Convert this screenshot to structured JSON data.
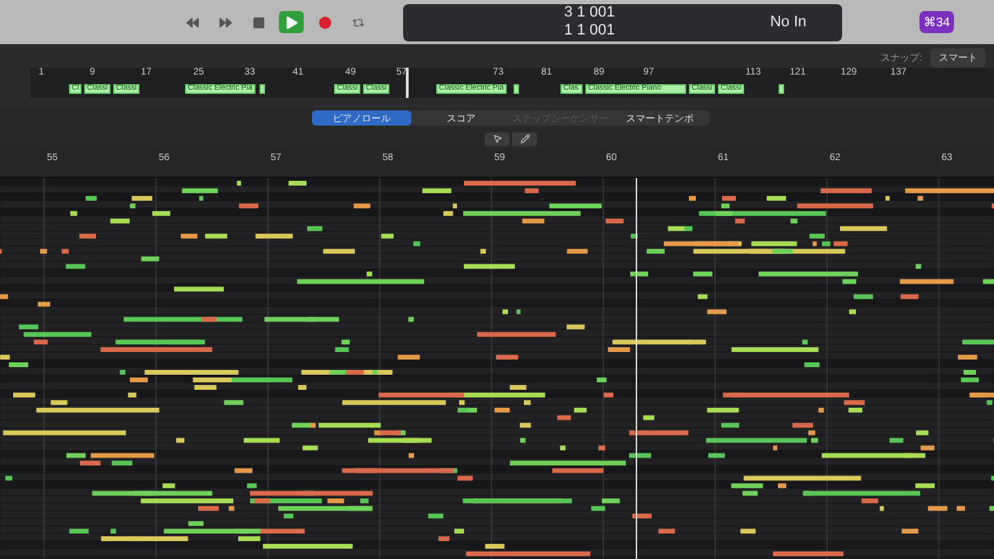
{
  "transport": {
    "buttons": [
      {
        "kind": "rewind",
        "active": false
      },
      {
        "kind": "forward",
        "active": false
      },
      {
        "kind": "stop",
        "active": false
      },
      {
        "kind": "play",
        "active": true
      },
      {
        "kind": "record",
        "active": false
      },
      {
        "kind": "cycle",
        "active": false
      }
    ]
  },
  "lcd": {
    "position_top": "3 1 001",
    "position_bottom": "1 1 001",
    "input": "No In"
  },
  "badge": "⌘34",
  "snap": {
    "label": "スナップ:",
    "value": "スマート"
  },
  "overview": {
    "bars": [
      "1",
      "9",
      "17",
      "25",
      "33",
      "41",
      "49",
      "57",
      "73",
      "81",
      "89",
      "97",
      "113",
      "121",
      "129",
      "137"
    ],
    "regions": [
      {
        "kind": "named",
        "name": "Cl"
      },
      {
        "kind": "named",
        "name": "Classi"
      },
      {
        "kind": "named",
        "name": "Classi"
      },
      {
        "kind": "named",
        "name": "Classic Electric Pia"
      },
      {
        "kind": "sliver"
      },
      {
        "kind": "named",
        "name": "Classi"
      },
      {
        "kind": "named",
        "name": "Classi"
      },
      {
        "kind": "named",
        "name": "Classic Electric Pia"
      },
      {
        "kind": "sliver"
      },
      {
        "kind": "named",
        "name": "Clas"
      },
      {
        "kind": "named",
        "name": "Classic Electric Piano"
      },
      {
        "kind": "named",
        "name": "Classi"
      },
      {
        "kind": "named",
        "name": "Classi"
      },
      {
        "kind": "sliver"
      }
    ]
  },
  "tabs": [
    {
      "label": "ピアノロール",
      "selected": true,
      "disabled": false
    },
    {
      "label": "スコア",
      "selected": false,
      "disabled": false
    },
    {
      "label": "ステップシーケンサー",
      "selected": false,
      "disabled": true
    },
    {
      "label": "スマートテンポ",
      "selected": false,
      "disabled": false
    }
  ],
  "editor": {
    "bars": [
      "55",
      "56",
      "57",
      "58",
      "59",
      "60",
      "61",
      "62",
      "63"
    ]
  }
}
